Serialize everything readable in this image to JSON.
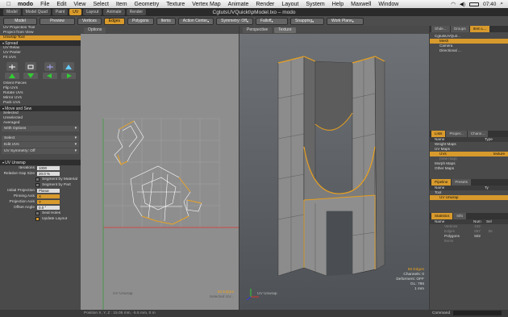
{
  "menubar": {
    "apple": "",
    "items": [
      "modo",
      "File",
      "Edit",
      "View",
      "Select",
      "Item",
      "Geometry",
      "Texture",
      "Vertex Map",
      "Animate",
      "Render",
      "Layout",
      "System",
      "Help",
      "Maxwell",
      "Window"
    ],
    "clock": "07:40"
  },
  "window": {
    "title": "CgtutsUVQuickt\\pModel.lxo – modo",
    "tabs": [
      "Model",
      "Model Quad",
      "Paint",
      "UV",
      "Layout",
      "Animate",
      "Render"
    ],
    "active_tab": "UV"
  },
  "toolbar": {
    "model": "Model",
    "preview": "Preview",
    "vertices": "Vertices",
    "edges": "Edges",
    "polygons": "Polygons",
    "items": "Items",
    "action_center": "Action Center",
    "symmetry": "Symmetry: Off",
    "falloff": "Falloff",
    "snapping": "Snapping",
    "work_plane": "Work Plane"
  },
  "left": {
    "tools": [
      "UV Projection Tool",
      "Project from View",
      "Unwrap Tool"
    ],
    "highlight_tool": "Unwrap Tool",
    "spread_header": "Spread",
    "spread_items": [
      "UV Relax",
      "UV Peeler",
      "Fit UVs"
    ],
    "orient_items": [
      "Orient Pieces",
      "Flip UVs",
      "Rotate UVs",
      "Mirror UVs",
      "Pack UVs"
    ],
    "move_header": "Move and Sew",
    "move_items": [
      "Selected",
      "Unselected",
      "Averaged",
      "With Options"
    ],
    "select_items": [
      "Select",
      "Edit UVs",
      "UV Symmetry: Off"
    ],
    "unwrap_header": "UV Unwrap",
    "fields": [
      {
        "label": "Iterations",
        "value": "1000"
      },
      {
        "label": "Relative Gap Size",
        "value": "20.0 %"
      }
    ],
    "checks1": [
      "Segment by Material",
      "Segment by Part"
    ],
    "fields2": [
      {
        "label": "Initial Projection",
        "value": "Planar"
      },
      {
        "label": "Pinning Axis",
        "value": "X"
      },
      {
        "label": "Projection Axis",
        "value": "Y"
      },
      {
        "label": "Offset Angle",
        "value": "0.0 °"
      }
    ],
    "checks2": [
      {
        "label": "Seal Holes",
        "on": false
      },
      {
        "label": "Update Layout",
        "on": true
      }
    ]
  },
  "uv_view": {
    "tab": "Options",
    "footer": "UV Unwrap",
    "count": "55 Edges",
    "stats": "Selected UV..."
  },
  "persp_view": {
    "tabs": [
      "Perspective",
      "Texture"
    ],
    "footer": "UV Unwrap",
    "count": "55 Edges",
    "channels": "Channels: 0",
    "deformers": "Deformers: OFF",
    "gl": "GL: 786",
    "scale": "1 mm"
  },
  "right": {
    "tabs1": [
      "Shde...",
      "Groups",
      "Item L..."
    ],
    "items_tree": [
      "CgtutsUVQuir...",
      "Mesh",
      "Camera",
      "Directional ..."
    ],
    "tabs2": [
      "Lists",
      "Proper...",
      "Chann..."
    ],
    "list_cols": [
      "Name",
      "Type"
    ],
    "list_items": [
      "Weight Maps",
      "UV Maps",
      "Morph Maps",
      "Other Maps"
    ],
    "uv_child": "UVs",
    "uv_child_type": "texture",
    "tabs3": [
      "Pipeline",
      "Presets"
    ],
    "pipeline_cols": [
      "Name",
      "Ty"
    ],
    "pipeline_items": [
      "Tool",
      "UV Unwrap"
    ],
    "tabs4": [
      "Statistics",
      "Info"
    ],
    "stat_cols": [
      "Name",
      "Num",
      "Sel"
    ],
    "stats": [
      {
        "name": "Vertices",
        "num": "432",
        "sel": ""
      },
      {
        "name": "Edges",
        "num": "857",
        "sel": "55"
      },
      {
        "name": "Polygons",
        "num": "502",
        "sel": ""
      },
      {
        "name": "Items",
        "num": "",
        "sel": ""
      }
    ]
  },
  "statusbar": "Position X, Y, Z : 15.05 mm, -5.5 mm, 0 m",
  "command_label": "Command"
}
